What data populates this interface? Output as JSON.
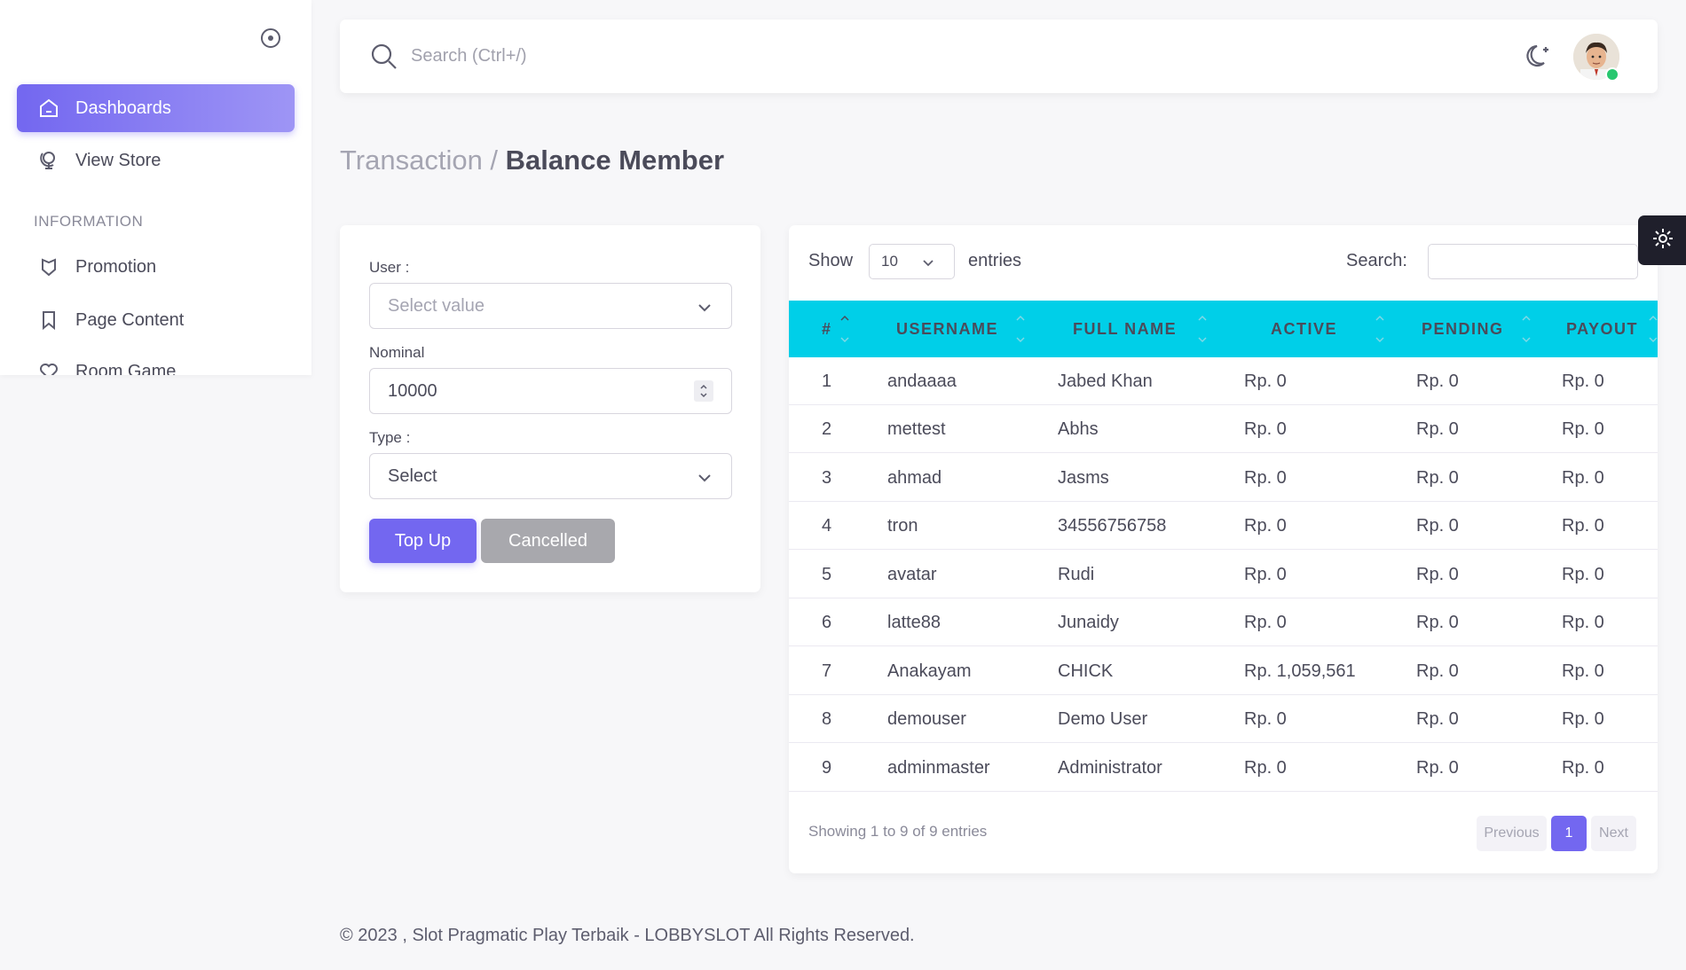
{
  "sidebar": {
    "items": [
      {
        "label": "Dashboards",
        "icon": "home-icon"
      },
      {
        "label": "View Store",
        "icon": "globe-icon"
      },
      {
        "label": "Promotion",
        "icon": "tag-icon"
      },
      {
        "label": "Page Content",
        "icon": "bookmark-icon"
      },
      {
        "label": "Room Game",
        "icon": "heart-icon"
      }
    ],
    "section_title": "INFORMATION"
  },
  "topbar": {
    "search_placeholder": "Search (Ctrl+/)"
  },
  "breadcrumb": {
    "parent": "Transaction /",
    "current": "Balance Member"
  },
  "form": {
    "user_label": "User :",
    "user_placeholder": "Select value",
    "nominal_label": "Nominal",
    "nominal_value": "10000",
    "type_label": "Type :",
    "type_value": "Select",
    "topup_button": "Top Up",
    "cancel_button": "Cancelled"
  },
  "table": {
    "show_label": "Show",
    "page_length": "10",
    "entries_label": "entries",
    "search_label": "Search:",
    "columns": [
      "#",
      "USERNAME",
      "FULL NAME",
      "ACTIVE",
      "PENDING",
      "PAYOUT"
    ],
    "rows": [
      [
        "1",
        "andaaaa",
        "Jabed Khan",
        "Rp. 0",
        "Rp. 0",
        "Rp. 0"
      ],
      [
        "2",
        "mettest",
        "Abhs",
        "Rp. 0",
        "Rp. 0",
        "Rp. 0"
      ],
      [
        "3",
        "ahmad",
        "Jasms",
        "Rp. 0",
        "Rp. 0",
        "Rp. 0"
      ],
      [
        "4",
        "tron",
        "34556756758",
        "Rp. 0",
        "Rp. 0",
        "Rp. 0"
      ],
      [
        "5",
        "avatar",
        "Rudi",
        "Rp. 0",
        "Rp. 0",
        "Rp. 0"
      ],
      [
        "6",
        "latte88",
        "Junaidy",
        "Rp. 0",
        "Rp. 0",
        "Rp. 0"
      ],
      [
        "7",
        "Anakayam",
        "CHICK",
        "Rp. 1,059,561",
        "Rp. 0",
        "Rp. 0"
      ],
      [
        "8",
        "demouser",
        "Demo User",
        "Rp. 0",
        "Rp. 0",
        "Rp. 0"
      ],
      [
        "9",
        "adminmaster",
        "Administrator",
        "Rp. 0",
        "Rp. 0",
        "Rp. 0"
      ]
    ],
    "info": "Showing 1 to 9 of 9 entries",
    "prev_label": "Previous",
    "current_page": "1",
    "next_label": "Next"
  },
  "footer": {
    "text": "© 2023 , Slot Pragmatic Play Terbaik - LOBBYSLOT All Rights Reserved."
  },
  "colors": {
    "primary": "#7367f0",
    "table_header": "#00cfe8",
    "secondary_button": "#a8a8ad",
    "online": "#28c76f"
  }
}
